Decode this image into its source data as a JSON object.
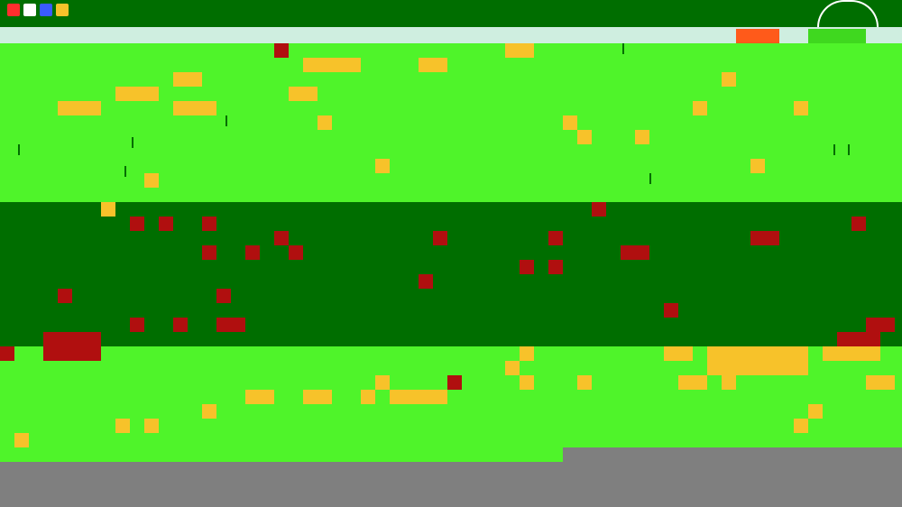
{
  "game": {
    "palette": {
      "sky_grass": "#4ff42a",
      "dark_grass": "#006e00",
      "coin": "#f7c22a",
      "brick": "#b00f0f",
      "ground": "#7f7f7f",
      "hud": "#cfeee0"
    },
    "icons": [
      "hud-icon",
      "hud-icon",
      "hud-icon",
      "hud-icon"
    ]
  }
}
